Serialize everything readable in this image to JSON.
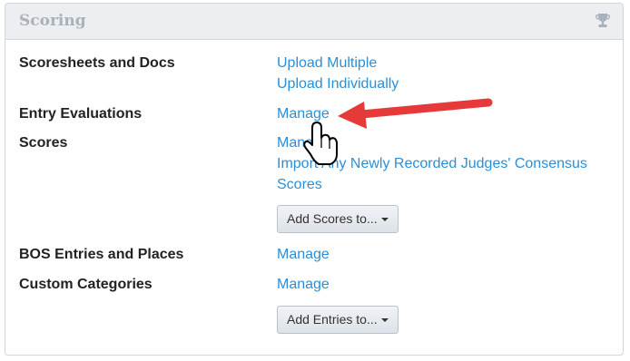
{
  "panel": {
    "title": "Scoring",
    "icon": "trophy-icon"
  },
  "rows": {
    "scoresheets": {
      "label": "Scoresheets and Docs",
      "links": [
        "Upload Multiple",
        "Upload Individually"
      ]
    },
    "evaluations": {
      "label": "Entry Evaluations",
      "link": "Manage"
    },
    "scores": {
      "label": "Scores",
      "link_partial": "Manage",
      "import_link_line1": "Import Any Newly Recorded Judges' Consensus",
      "import_link_line2": "Scores",
      "button": "Add Scores to..."
    },
    "bos": {
      "label": "BOS Entries and Places",
      "link": "Manage"
    },
    "custom": {
      "label": "Custom Categories",
      "link": "Manage",
      "button": "Add Entries to..."
    }
  },
  "annotation": {
    "arrow_color": "#e5393a",
    "pointer": "hand-cursor-icon"
  }
}
